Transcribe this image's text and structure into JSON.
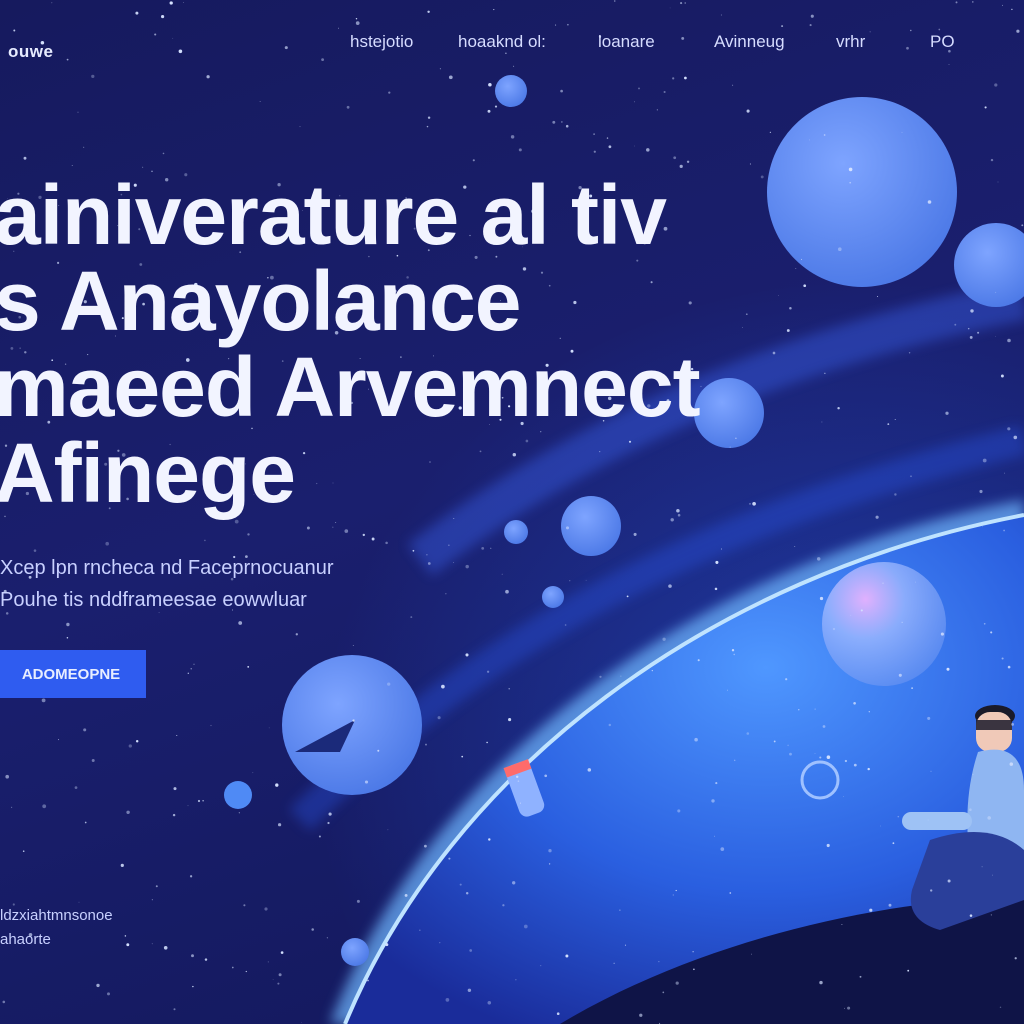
{
  "brand": {
    "logo_text": "ouwe"
  },
  "nav": {
    "items": [
      {
        "label": "hstejotio"
      },
      {
        "label": "hoaaknd ol:"
      },
      {
        "label": "loanare"
      },
      {
        "label": "Avinneug"
      },
      {
        "label": "vrhr"
      },
      {
        "label": "PO"
      }
    ]
  },
  "hero": {
    "headline_lines": [
      "ainiverature al tiv",
      "s Anayolance",
      "maeed Arvemnect",
      "Afinege"
    ],
    "subtitle_lines": [
      "Xcep lpn rncheca  nd  Faceprnocuanur",
      "Pouhe  tis  nddframeesae eowwluar"
    ],
    "cta_label": "ADOMEOPNE"
  },
  "footer": {
    "text_lines": [
      "ldzxiahtmnsonoe",
      "ahaorte"
    ]
  },
  "colors": {
    "background": "#14185a",
    "accent": "#2f5cf0",
    "planet_glow": "#3f8cff",
    "bubble": "#5b86ee"
  }
}
